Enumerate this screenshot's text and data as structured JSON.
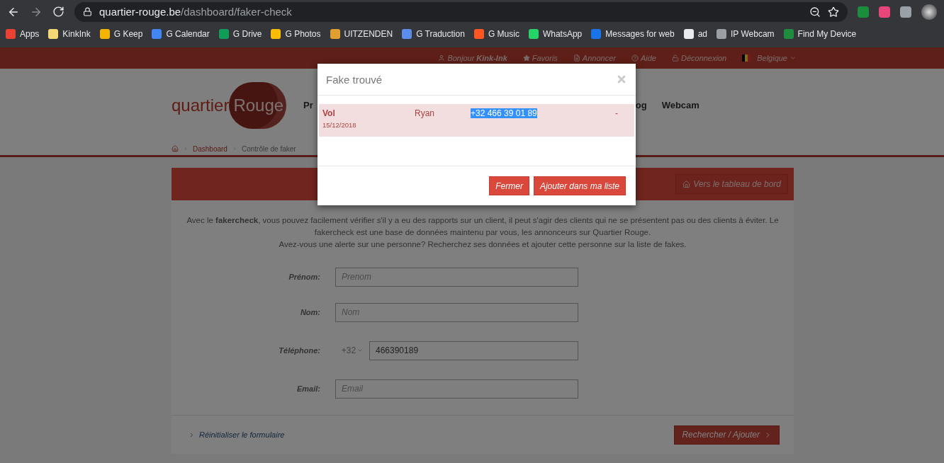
{
  "browser": {
    "url_host": "quartier-rouge.be",
    "url_path": "/dashboard/faker-check",
    "bookmarks": [
      {
        "label": "Apps",
        "color": "#e94235"
      },
      {
        "label": "KinkInk",
        "color": "#f6d776"
      },
      {
        "label": "G Keep",
        "color": "#f4b400"
      },
      {
        "label": "G Calendar",
        "color": "#4285f4"
      },
      {
        "label": "G Drive",
        "color": "#0f9d58"
      },
      {
        "label": "G Photos",
        "color": "#fbbc04"
      },
      {
        "label": "UITZENDEN",
        "color": "#e0a030"
      },
      {
        "label": "G Traduction",
        "color": "#5b8def"
      },
      {
        "label": "G Music",
        "color": "#ff5722"
      },
      {
        "label": "WhatsApp",
        "color": "#25d366"
      },
      {
        "label": "Messages for web",
        "color": "#1a73e8"
      },
      {
        "label": "ad",
        "color": "#e8eaed"
      },
      {
        "label": "IP Webcam",
        "color": "#9aa0a6"
      },
      {
        "label": "Find My Device",
        "color": "#1e8e3e"
      }
    ]
  },
  "topbar": {
    "links": [
      {
        "kind": "user",
        "label": "Bonjour **Kink-Ink**"
      },
      {
        "kind": "star",
        "label": "Favoris"
      },
      {
        "kind": "file",
        "label": "Annoncer"
      },
      {
        "kind": "help",
        "label": "Aide"
      },
      {
        "kind": "unlock",
        "label": "Déconnexion"
      },
      {
        "kind": "country",
        "label": "Belgique"
      }
    ]
  },
  "header": {
    "logo_left": "quartier",
    "logo_right": "Rouge",
    "nav": [
      {
        "label": "Pr"
      },
      {
        "label": "og"
      },
      {
        "label": "Webcam"
      }
    ]
  },
  "breadcrumb": [
    "Dashboard",
    "Contrôle de faker"
  ],
  "panel": {
    "header_button": "Vers le tableau de bord",
    "intro": [
      "Avec le **fakercheck**, vous pouvez facilement vérifier s'il y a eu des rapports sur un client, il peut s'agir des clients qui ne se présentent pas ou des clients à éviter. Le fakercheck est une base de données maintenu par vous, les annonceurs sur Quartier Rouge.",
      "Avez-vous une alerte sur une personne? Recherchez ses données et ajouter cette personne sur la liste de fakes."
    ],
    "fields": [
      {
        "kind": "text",
        "label": "Prénom:",
        "placeholder": "Prenom"
      },
      {
        "kind": "text",
        "label": "Nom:",
        "placeholder": "Nom"
      },
      {
        "kind": "phone",
        "label": "Téléphone:",
        "prefix": "+32",
        "value": "466390189"
      },
      {
        "kind": "text",
        "label": "Email:",
        "placeholder": "Email"
      }
    ],
    "reset_link": "Réinitialiser le formulaire",
    "submit": "Rechercher / Ajouter"
  },
  "modal": {
    "title": "Fake trouvé",
    "rows": [
      {
        "type": "Vol",
        "date": "15/12/2018",
        "name": "Ryan",
        "phone": "+32 466 39 01 89",
        "phone_highlighted": true,
        "column_4": "-"
      }
    ],
    "buttons": [
      "Fermer",
      "Ajouter dans ma liste"
    ]
  }
}
